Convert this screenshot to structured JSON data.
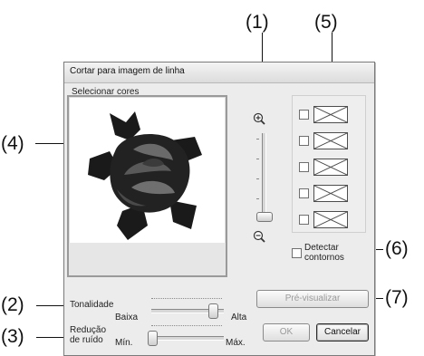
{
  "callouts": {
    "c1": "(1)",
    "c2": "(2)",
    "c3": "(3)",
    "c4": "(4)",
    "c5": "(5)",
    "c6": "(6)",
    "c7": "(7)"
  },
  "dialog": {
    "title": "Cortar para imagem de linha",
    "select_colors_label": "Selecionar cores",
    "detect_contours_label_line1": "Detectar",
    "detect_contours_label_line2": "contornos",
    "preview_button": "Pré-visualizar",
    "tone_label": "Tonalidade",
    "tone_low": "Baixa",
    "tone_high": "Alta",
    "noise_label_line1": "Redução",
    "noise_label_line2": "de ruído",
    "noise_min": "Mín.",
    "noise_max": "Máx.",
    "ok_button": "OK",
    "cancel_button": "Cancelar",
    "tone_value": 0.95,
    "noise_value": 0.0,
    "zoom_value": 0.0,
    "color_slots": [
      {
        "checked": false,
        "icon": "empty-swatch-icon"
      },
      {
        "checked": false,
        "icon": "empty-swatch-icon"
      },
      {
        "checked": false,
        "icon": "empty-swatch-icon"
      },
      {
        "checked": false,
        "icon": "empty-swatch-icon"
      },
      {
        "checked": false,
        "icon": "empty-swatch-icon"
      }
    ],
    "icons": {
      "zoom_in": "zoom-in-icon",
      "zoom_out": "zoom-out-icon"
    }
  }
}
